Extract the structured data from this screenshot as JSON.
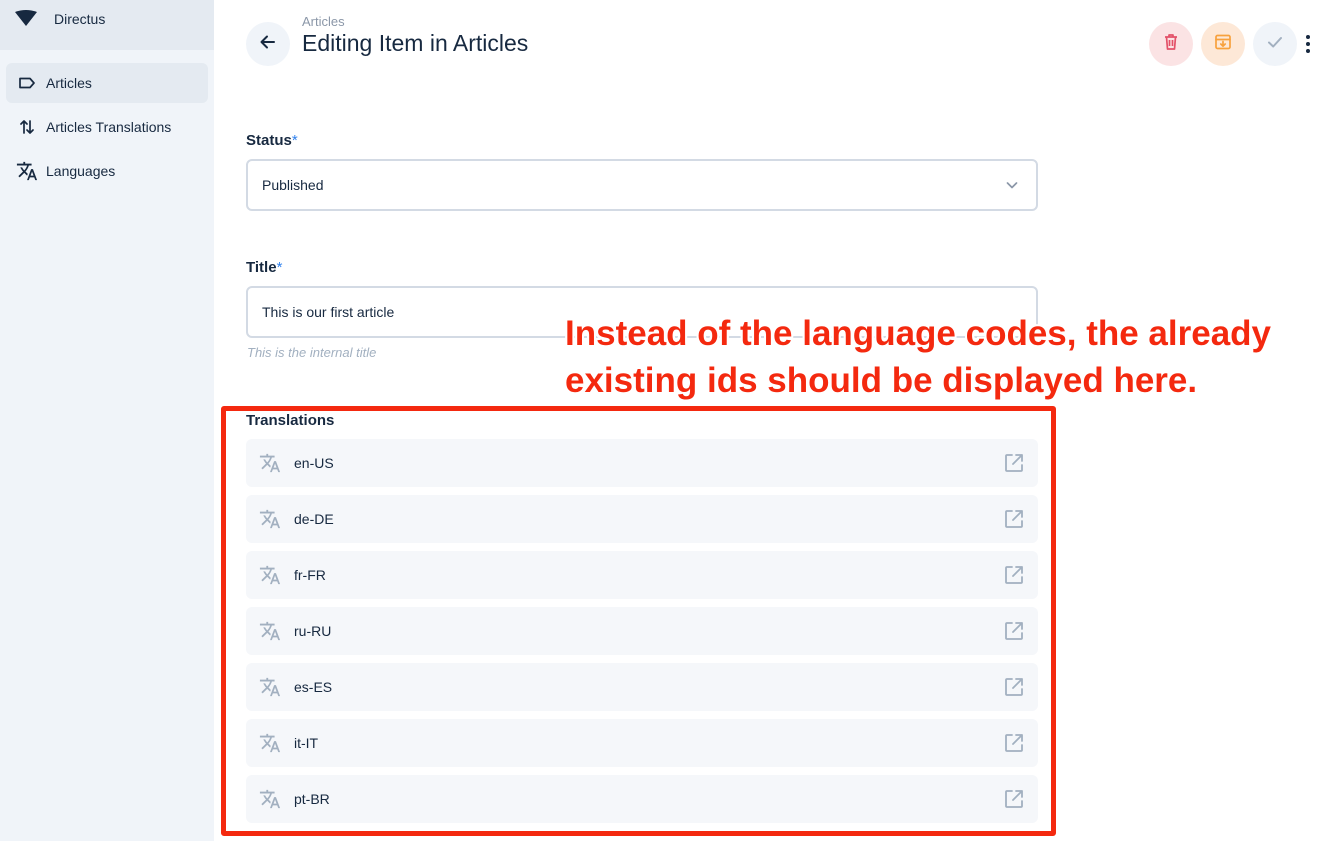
{
  "app": {
    "project_name": "Directus"
  },
  "sidebar": {
    "items": [
      {
        "label": "Articles",
        "icon": "label-icon",
        "active": true
      },
      {
        "label": "Articles Translations",
        "icon": "sort-arrows-icon",
        "active": false
      },
      {
        "label": "Languages",
        "icon": "translate-icon",
        "active": false
      }
    ]
  },
  "header": {
    "breadcrumb": "Articles",
    "title": "Editing Item in Articles"
  },
  "form": {
    "status": {
      "label": "Status",
      "required_mark": "*",
      "value": "Published"
    },
    "title": {
      "label": "Title",
      "required_mark": "*",
      "value": "This is our first article",
      "hint": "This is the internal title"
    },
    "translations": {
      "label": "Translations",
      "items": [
        {
          "code": "en-US"
        },
        {
          "code": "de-DE"
        },
        {
          "code": "fr-FR"
        },
        {
          "code": "ru-RU"
        },
        {
          "code": "es-ES"
        },
        {
          "code": "it-IT"
        },
        {
          "code": "pt-BR"
        }
      ]
    }
  },
  "annotation": {
    "line1": "Instead of the language codes, the already",
    "line2": "existing ids should be displayed here."
  },
  "colors": {
    "sidebar_bg": "#f0f4f9",
    "accent": "#2f80ed",
    "danger": "#e35169",
    "warning": "#f7a13d",
    "annotation": "#f4290f"
  }
}
